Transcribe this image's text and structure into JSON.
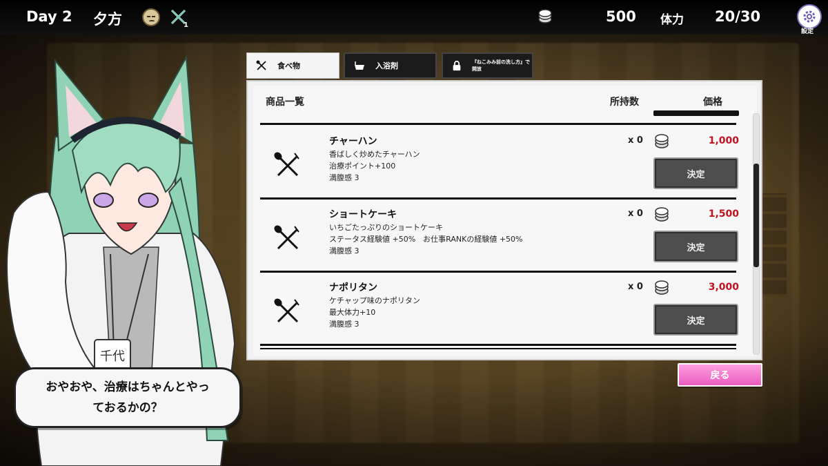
{
  "hud": {
    "day": "Day 2",
    "time_of_day": "夕方",
    "mood_icon": "face-icon",
    "cutlery_count": "1",
    "money": "500",
    "stamina_label": "体力",
    "stamina": "20/30",
    "settings_label": "設定"
  },
  "tabs": [
    {
      "label": "食べ物",
      "icon": "cutlery-icon",
      "active": true
    },
    {
      "label": "入浴剤",
      "icon": "bathtub-icon",
      "active": false
    },
    {
      "label": "『ねこみみ前の洗し方』で開放",
      "icon": "lock-icon",
      "active": false
    }
  ],
  "shop": {
    "header_name": "商品一覧",
    "header_owned": "所持数",
    "header_price": "価格",
    "items": [
      {
        "name": "チャーハン",
        "desc1": "香ばしく炒めたチャーハン",
        "desc2": "治療ポイント+100",
        "desc3": "満腹感 3",
        "owned": "x 0",
        "price": "1,000",
        "button": "決定"
      },
      {
        "name": "ショートケーキ",
        "desc1": "いちごたっぷりのショートケーキ",
        "desc2": "ステータス経験値 +50%　お仕事RANKの経験値 +50%",
        "desc3": "満腹感 3",
        "owned": "x 0",
        "price": "1,500",
        "button": "決定"
      },
      {
        "name": "ナポリタン",
        "desc1": "ケチャップ味のナポリタン",
        "desc2": "最大体力+10",
        "desc3": "満腹感 3",
        "owned": "x 0",
        "price": "3,000",
        "button": "決定"
      }
    ]
  },
  "back_button": "戻る",
  "dialogue": {
    "line1": "おやおや、治療はちゃんとやっ",
    "line2": "ておるかの？"
  },
  "character": {
    "name_tag": "千代"
  },
  "colors": {
    "price_red": "#c1121f",
    "back_pink": "#ea5cbf",
    "hair_mint": "#8fd3b4"
  }
}
